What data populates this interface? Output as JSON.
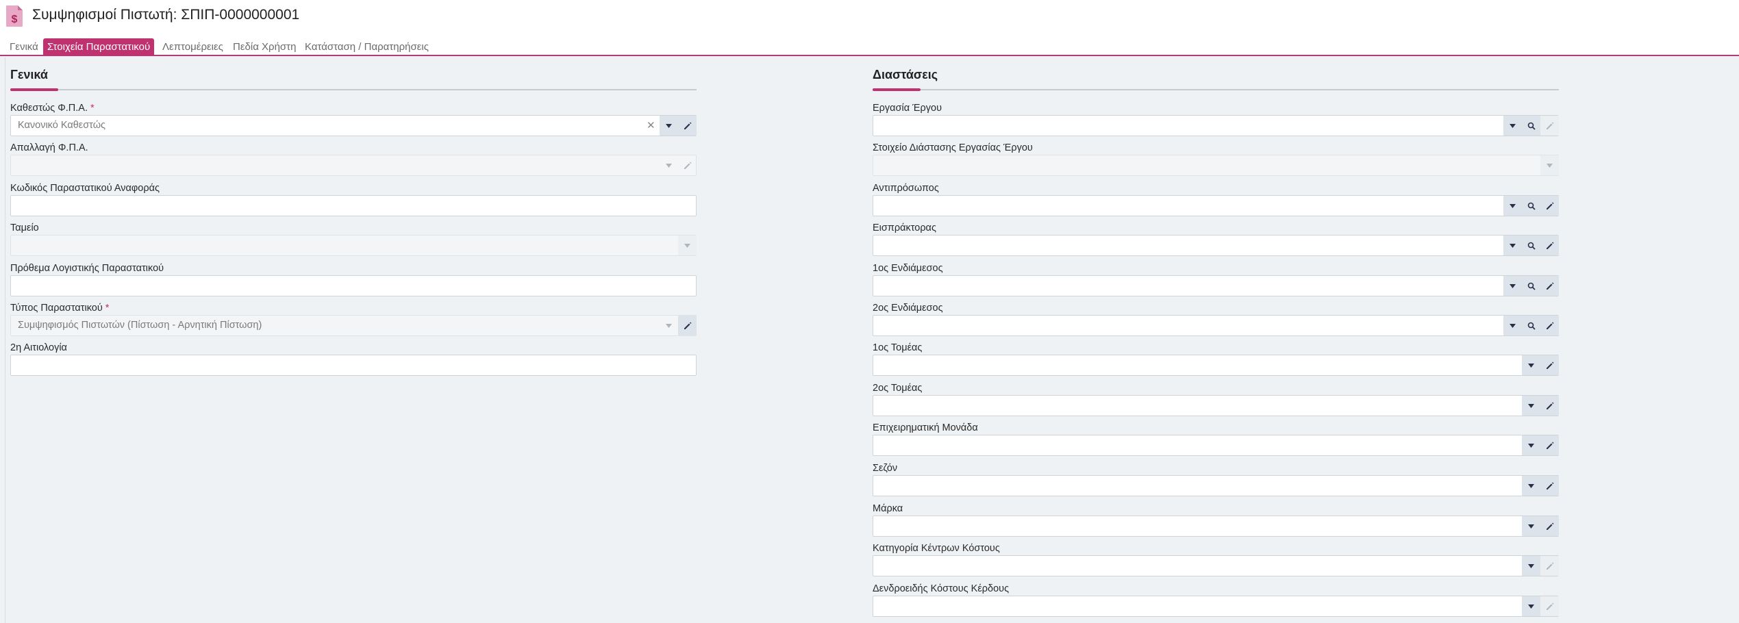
{
  "header": {
    "title": "Συμψηφισμοί Πιστωτή: ΣΠΙΠ-0000000001",
    "icon": "document-dollar-icon"
  },
  "tabs": [
    {
      "label": "Γενικά"
    },
    {
      "label": "Στοιχεία Παραστατικού"
    },
    {
      "label": "Λεπτομέρειες"
    },
    {
      "label": "Πεδία Χρήστη"
    },
    {
      "label": "Κατάσταση / Παρατηρήσεις"
    }
  ],
  "active_tab": "Στοιχεία Παραστατικού",
  "left": {
    "title": "Γενικά",
    "fields": [
      {
        "label": "Καθεστώς Φ.Π.Α.",
        "required": "*",
        "value": "Κανονικό Καθεστώς"
      },
      {
        "label": "Απαλλαγή Φ.Π.Α.",
        "value": ""
      },
      {
        "label": "Κωδικός Παραστατικού Αναφοράς",
        "value": ""
      },
      {
        "label": "Ταμείο",
        "value": ""
      },
      {
        "label": "Πρόθεμα Λογιστικής Παραστατικού",
        "value": ""
      },
      {
        "label": "Τύπος Παραστατικού",
        "required": "*",
        "value": "Συμψηφισμός Πιστωτών (Πίστωση - Αρνητική Πίστωση)"
      },
      {
        "label": "2η Αιτιολογία",
        "value": ""
      }
    ]
  },
  "right": {
    "title": "Διαστάσεις",
    "fields": [
      {
        "label": "Εργασία Έργου",
        "value": ""
      },
      {
        "label": "Στοιχείο Διάστασης Εργασίας Έργου",
        "value": ""
      },
      {
        "label": "Αντιπρόσωπος",
        "value": ""
      },
      {
        "label": "Εισπράκτορας",
        "value": ""
      },
      {
        "label": "1ος Ενδιάμεσος",
        "value": ""
      },
      {
        "label": "2ος Ενδιάμεσος",
        "value": ""
      },
      {
        "label": "1ος Τομέας",
        "value": ""
      },
      {
        "label": "2ος Τομέας",
        "value": ""
      },
      {
        "label": "Επιχειρηματική Μονάδα",
        "value": ""
      },
      {
        "label": "Σεζόν",
        "value": ""
      },
      {
        "label": "Μάρκα",
        "value": ""
      },
      {
        "label": "Κατηγορία Κέντρων Κόστους",
        "value": ""
      },
      {
        "label": "Δενδροειδής Κόστους Κέρδους",
        "value": ""
      }
    ]
  },
  "colors": {
    "accent": "#c0326f",
    "background": "#eff2f4",
    "button": "#dde3ea"
  }
}
